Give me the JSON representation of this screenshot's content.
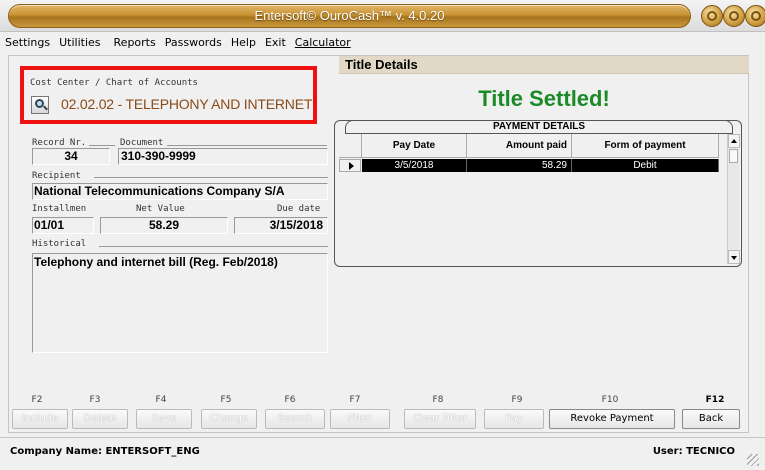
{
  "window": {
    "title": "Entersoft© OuroCash™ v. 4.0.20",
    "controls": [
      "minimize",
      "maximize",
      "close"
    ]
  },
  "menu": {
    "settings": "Settings",
    "utilities": "Utilities",
    "reports": "Reports",
    "passwords": "Passwords",
    "help": "Help",
    "exit": "Exit",
    "calculator": "Calculator"
  },
  "cost_center": {
    "label": "Cost Center / Chart of Accounts",
    "value": "02.02.02 - TELEPHONY AND INTERNET",
    "icon": "magnifier-icon"
  },
  "record": {
    "record_label": "Record Nr.",
    "record_value": "34",
    "document_label": "Document",
    "document_value": "310-390-9999",
    "recipient_label": "Recipient",
    "recipient_value": "National Telecommunications Company S/A",
    "installment_label": "Installmen",
    "installment_value": "01/01",
    "net_value_label": "Net Value",
    "net_value": "58.29",
    "due_date_label": "Due date",
    "due_date": "3/15/2018",
    "historical_label": "Historical",
    "historical_value": "Telephony and internet bill (Reg. Feb/2018)"
  },
  "title_details": {
    "header": "Title Details",
    "status": "Title Settled!",
    "status_color": "#1d8a2a"
  },
  "payment_details": {
    "title": "PAYMENT DETAILS",
    "columns": [
      "Pay Date",
      "Amount paid",
      "Form of payment"
    ],
    "rows": [
      {
        "pay_date": "3/5/2018",
        "amount_paid": "58.29",
        "form_of_payment": "Debit"
      }
    ]
  },
  "function_keys": [
    {
      "key": "F2",
      "label": "Include",
      "enabled": false
    },
    {
      "key": "F3",
      "label": "Delete",
      "enabled": false
    },
    {
      "key": "F4",
      "label": "Save",
      "enabled": false
    },
    {
      "key": "F5",
      "label": "Change",
      "enabled": false
    },
    {
      "key": "F6",
      "label": "Search",
      "enabled": false
    },
    {
      "key": "F7",
      "label": "Filter",
      "enabled": false
    },
    {
      "key": "F8",
      "label": "Clear Filter",
      "enabled": false
    },
    {
      "key": "F9",
      "label": "Pay",
      "enabled": false
    },
    {
      "key": "F10",
      "label": "Revoke Payment",
      "enabled": true
    },
    {
      "key": "F12",
      "label": "Back",
      "enabled": true
    }
  ],
  "status_bar": {
    "company": "Company Name: ENTERSOFT_ENG",
    "user": "User: TECNICO"
  },
  "colors": {
    "highlight_border": "#ee1111",
    "cost_center_text": "#8a4a18",
    "title_bar": "#c89232",
    "header_band": "#e1d8c6"
  }
}
